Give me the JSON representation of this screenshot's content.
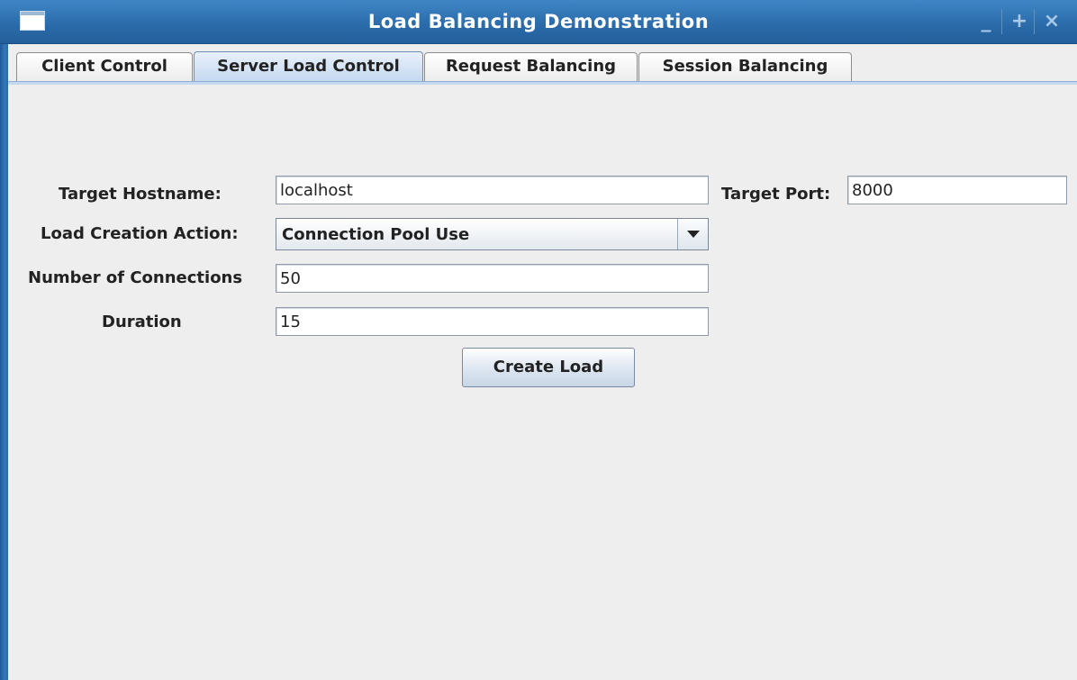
{
  "window": {
    "title": "Load Balancing Demonstration",
    "controls": {
      "minimize": "_",
      "maximize": "+",
      "close": "×"
    }
  },
  "tabs": [
    {
      "label": "Client Control",
      "active": false
    },
    {
      "label": "Server Load Control",
      "active": true
    },
    {
      "label": "Request Balancing",
      "active": false
    },
    {
      "label": "Session Balancing",
      "active": false
    }
  ],
  "form": {
    "hostname_label": "Target Hostname:",
    "hostname_value": "localhost",
    "port_label": "Target Port:",
    "port_value": "8000",
    "action_label": "Load Creation Action:",
    "action_value": "Connection Pool Use",
    "connections_label": "Number of Connections",
    "connections_value": "50",
    "duration_label": "Duration",
    "duration_value": "15",
    "create_button": "Create Load"
  },
  "icons": {
    "window_menu": "window-menu-icon",
    "combo_arrow": "chevron-down-icon"
  },
  "colors": {
    "titlebar": "#2a6aa9",
    "active_tab": "#c4d8f0",
    "background": "#eeeeee"
  }
}
